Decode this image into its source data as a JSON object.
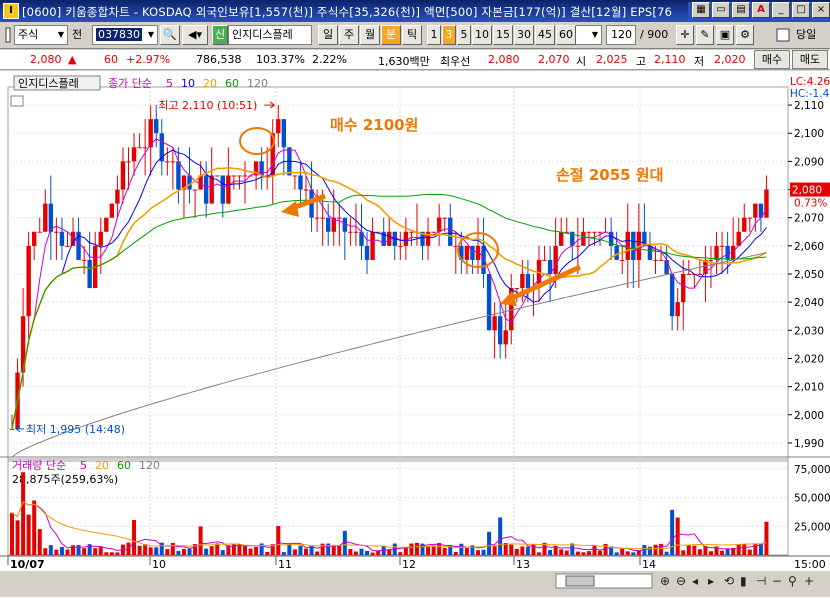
{
  "window": {
    "title": "[0600] 키움종합차트 - KOSDAQ 외국인보유[1,557(천)] 주식수[35,326(천)] 액면[500] 자본금[177(억)] 결산[12월] EPS[76",
    "app_icon": "I"
  },
  "toolbar": {
    "type_label": "주식",
    "prev_label": "전",
    "code": "037830",
    "sign_label": "신",
    "stock_name": "인지디스플레",
    "periods": [
      "일",
      "주",
      "월",
      "분",
      "틱"
    ],
    "active_period": "분",
    "intervals": [
      "1",
      "3",
      "5",
      "10",
      "15",
      "30",
      "45",
      "60"
    ],
    "active_interval": "3",
    "interval_value": "3",
    "count_value": "120",
    "count_total": "/ 900",
    "same_day_label": "당일"
  },
  "info": {
    "price": "2,080",
    "change_arrow": "▲",
    "change": "60",
    "change_pct": "+2.97%",
    "volume": "786,538",
    "vol_ratio": "103.37%",
    "turnover": "2.22%",
    "amount": "1,630백만",
    "best_label": "최우선",
    "best_ask": "2,080",
    "best_bid": "2,070",
    "open_label": "시",
    "open": "2,025",
    "high_label": "고",
    "high": "2,110",
    "low_label": "저",
    "low": "2,020",
    "sell_label": "매수",
    "buy_label": "매도"
  },
  "price_panel": {
    "tag": "인지디스플레",
    "ma_legend_prefix": "종가 단순",
    "ma_periods": [
      "5",
      "10",
      "20",
      "60",
      "120"
    ],
    "lc_label": "LC:4.26",
    "hc_label": "HC:-1.4",
    "current_price_tag": "2,080",
    "current_pct_tag": "0.73%",
    "high_label": "최고 2,110 (10:51)",
    "low_label": "최저 1,995 (14:48)",
    "y_ticks": [
      "2,110",
      "2,100",
      "2,090",
      "2,080",
      "2,070",
      "2,060",
      "2,050",
      "2,040",
      "2,030",
      "2,020",
      "2,010",
      "2,000",
      "1,990"
    ]
  },
  "annotations": {
    "buy_note": "매수 2100원",
    "stop_note": "손절 2055 원대"
  },
  "volume_panel": {
    "legend_prefix": "거래량 단순",
    "ma_periods": [
      "5",
      "20",
      "60",
      "120"
    ],
    "last_volume": "28,875주(259,63%)",
    "y_ticks": [
      "75,000",
      "50,000",
      "25,000"
    ]
  },
  "x_axis": {
    "labels": [
      "10/07",
      "10",
      "11",
      "12",
      "13",
      "14"
    ],
    "time_label": "15:00"
  },
  "colors": {
    "up": "#e60000",
    "down": "#0050d0",
    "ma5": "#cc00cc",
    "ma10": "#0000ff",
    "ma20": "#f0a000",
    "ma60": "#00a000",
    "ma120": "#808080",
    "annotation": "#f07800"
  }
}
